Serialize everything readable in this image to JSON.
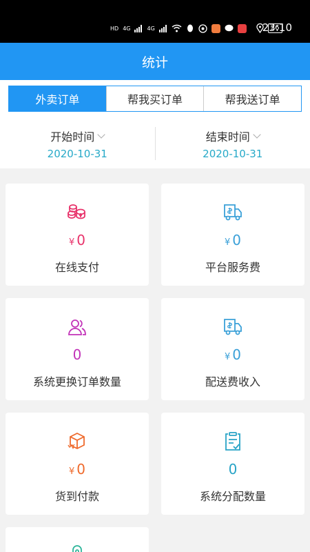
{
  "status_bar": {
    "network_1": "HD",
    "network_2": "4G",
    "network_3": "4G",
    "battery": "26",
    "time": "23:10"
  },
  "header": {
    "title": "统计"
  },
  "tabs": [
    {
      "label": "外卖订单",
      "active": true
    },
    {
      "label": "帮我买订单",
      "active": false
    },
    {
      "label": "帮我送订单",
      "active": false
    }
  ],
  "date_range": {
    "start": {
      "label": "开始时间",
      "value": "2020-10-31"
    },
    "end": {
      "label": "结束时间",
      "value": "2020-10-31"
    }
  },
  "currency_symbol": "¥",
  "stats": [
    {
      "label": "在线支付",
      "value": "0",
      "currency": true,
      "icon": "coins-stack-icon",
      "color": "#e8336b"
    },
    {
      "label": "平台服务费",
      "value": "0",
      "currency": true,
      "icon": "delivery-truck-icon",
      "color": "#3aa0d8"
    },
    {
      "label": "系统更换订单数量",
      "value": "0",
      "currency": false,
      "icon": "users-icon",
      "color": "#c233b8"
    },
    {
      "label": "配送费收入",
      "value": "0",
      "currency": true,
      "icon": "delivery-truck-icon",
      "color": "#3aa0d8"
    },
    {
      "label": "货到付款",
      "value": "0",
      "currency": true,
      "icon": "package-icon",
      "color": "#ef6a2c"
    },
    {
      "label": "系统分配数量",
      "value": "0",
      "currency": false,
      "icon": "clipboard-check-icon",
      "color": "#27a3c6"
    }
  ],
  "colors": {
    "primary": "#2196f3",
    "date_value": "#26a9c8"
  }
}
